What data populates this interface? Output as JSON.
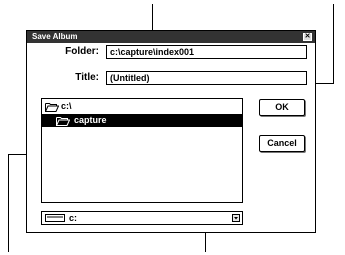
{
  "dialog": {
    "title": "Save Album",
    "close_glyph": "✕",
    "folder_label": "Folder:",
    "folder_value": "c:\\capture\\index001",
    "title_label": "Title:",
    "title_value": "(Untitled)",
    "tree": [
      {
        "label": "c:\\",
        "icon": "open-folder-icon",
        "selected": false
      },
      {
        "label": "capture",
        "icon": "open-folder-icon",
        "selected": true
      }
    ],
    "ok_label": "OK",
    "cancel_label": "Cancel",
    "drive_value": "c:",
    "drive_icon": "drive-icon",
    "dropdown_icon": "dropdown-arrow-icon"
  }
}
